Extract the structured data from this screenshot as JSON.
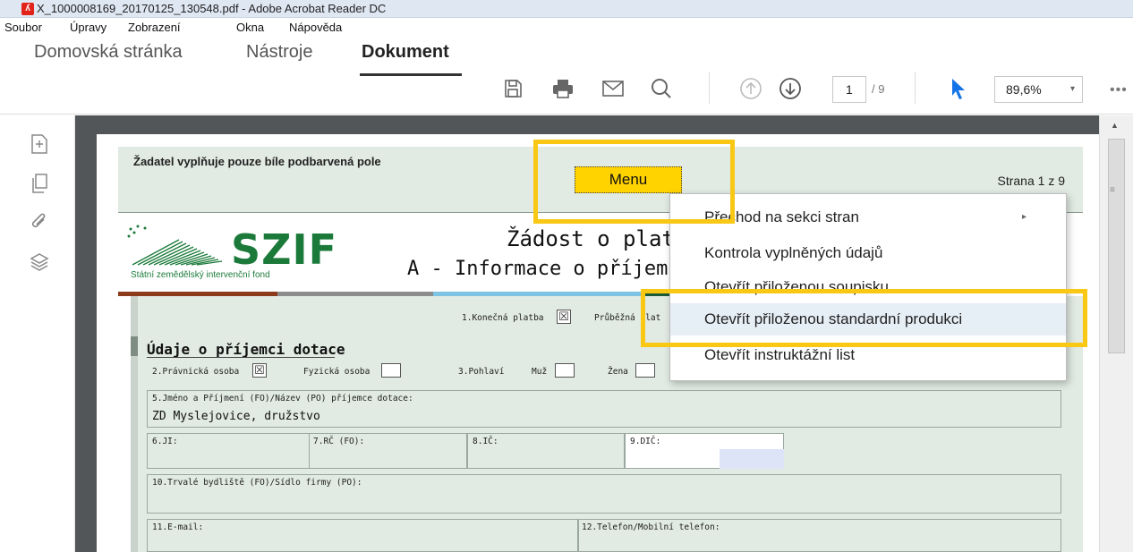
{
  "window": {
    "title": "X_1000008169_20170125_130548.pdf - Adobe Acrobat Reader DC",
    "app_icon": "acrobat-pdf-icon"
  },
  "menubar": [
    "Soubor",
    "Úpravy",
    "Zobrazení",
    "Okna",
    "Nápověda"
  ],
  "toolbar": {
    "tabs": [
      "Domovská stránka",
      "Nástroje",
      "Dokument"
    ],
    "active_tab": "Dokument",
    "icons": [
      "save-icon",
      "print-icon",
      "email-icon",
      "search-icon",
      "page-up-icon",
      "page-down-icon",
      "select-pointer-icon",
      "more-icon"
    ],
    "page_current": "1",
    "page_total": "/ 9",
    "zoom": "89,6%",
    "zoom_arrow": "▾",
    "more": "•••"
  },
  "left_rail": {
    "icons": [
      "export-icon",
      "pages-icon",
      "attachment-icon",
      "layers-icon"
    ]
  },
  "document": {
    "fill_note": "Žadatel vyplňuje pouze bíle podbarvená pole",
    "menu_button": "Menu",
    "page_label": "Strana 1 z 9",
    "logo": {
      "name": "SZIF",
      "subtitle": "Státní zemědělský intervenční fond"
    },
    "title1": "Žádost o platb",
    "title2": "A - Informace o příjemci",
    "payment_final_label": "1.Konečná platba",
    "payment_final_mark": "☒",
    "payment_partial_label": "Průběžná plat",
    "section_heading": "Údaje o příjemci dotace",
    "legal_person_label": "2.Právnická osoba",
    "legal_person_mark": "☒",
    "natural_person_label": "Fyzická osoba",
    "gender_label": "3.Pohlaví",
    "male_label": "Muž",
    "female_label": "Žena",
    "name_field_label": "5.Jméno a Příjmení (FO)/Název (PO) příjemce dotace:",
    "name_field_value": "ZD Myslejovice, družstvo",
    "ji_label": "6.JI:",
    "rc_label": "7.RČ (FO):",
    "ic_label": "8.IČ:",
    "dic_label": "9.DIČ:",
    "address_label": "10.Trvalé bydliště (FO)/Sídlo firmy (PO):",
    "email_label": "11.E-mail:",
    "phone_label": "12.Telefon/Mobilní telefon:"
  },
  "context_menu": {
    "items": [
      {
        "label": "Přechod na sekci stran",
        "submenu": "▸"
      },
      {
        "label": "Kontrola vyplněných údajů"
      },
      {
        "label": "Otevřít přiloženou soupisku"
      },
      {
        "label": "Otevřít přiloženou standardní produkci"
      },
      {
        "label": "Otevřít instruktážní list"
      }
    ],
    "highlighted_index": 3
  },
  "scrollbar": {
    "up_arrow": "▲",
    "grip": "≡"
  },
  "colors": {
    "accent_highlight": "#f9c814",
    "menu_button": "#ffd300",
    "form_background": "#e1eae3",
    "logo_green": "#1b7a3a",
    "pointer_blue": "#1473e6"
  }
}
